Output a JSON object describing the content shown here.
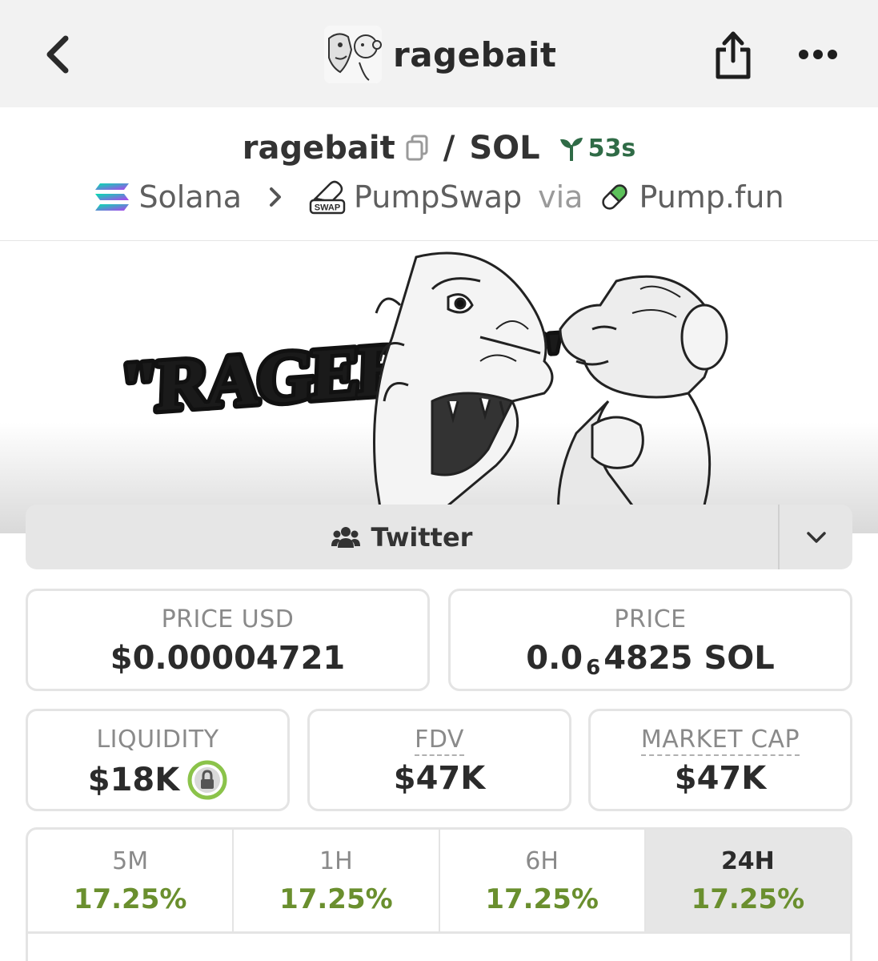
{
  "nav": {
    "title": "ragebait",
    "back_icon": "chevron-left-icon",
    "share_icon": "share-icon",
    "more_icon": "more-dots-icon"
  },
  "pair": {
    "base": "ragebait",
    "slash": "/",
    "quote": "SOL",
    "age": "53s",
    "chain": "Solana",
    "dex": "PumpSwap",
    "via": "via",
    "launchpad": "Pump.fun",
    "dex_badge": "SWAP"
  },
  "banner": {
    "logo_text": "\"RAGEBAIT\""
  },
  "links": {
    "twitter_label": "Twitter"
  },
  "stats": {
    "price_usd_label": "PRICE USD",
    "price_usd_value": "$0.00004721",
    "price_label": "PRICE",
    "price_prefix": "0.0",
    "price_subscript": "6",
    "price_suffix": "4825 SOL",
    "liquidity_label": "LIQUIDITY",
    "liquidity_value": "$18K",
    "fdv_label": "FDV",
    "fdv_value": "$47K",
    "mcap_label": "MARKET CAP",
    "mcap_value": "$47K"
  },
  "timeframes": [
    {
      "label": "5M",
      "value": "17.25%"
    },
    {
      "label": "1H",
      "value": "17.25%"
    },
    {
      "label": "6H",
      "value": "17.25%"
    },
    {
      "label": "24H",
      "value": "17.25%"
    }
  ],
  "colors": {
    "positive": "#6a8f2e",
    "age_green": "#2f6b46",
    "lock_green": "#8bc34a"
  }
}
